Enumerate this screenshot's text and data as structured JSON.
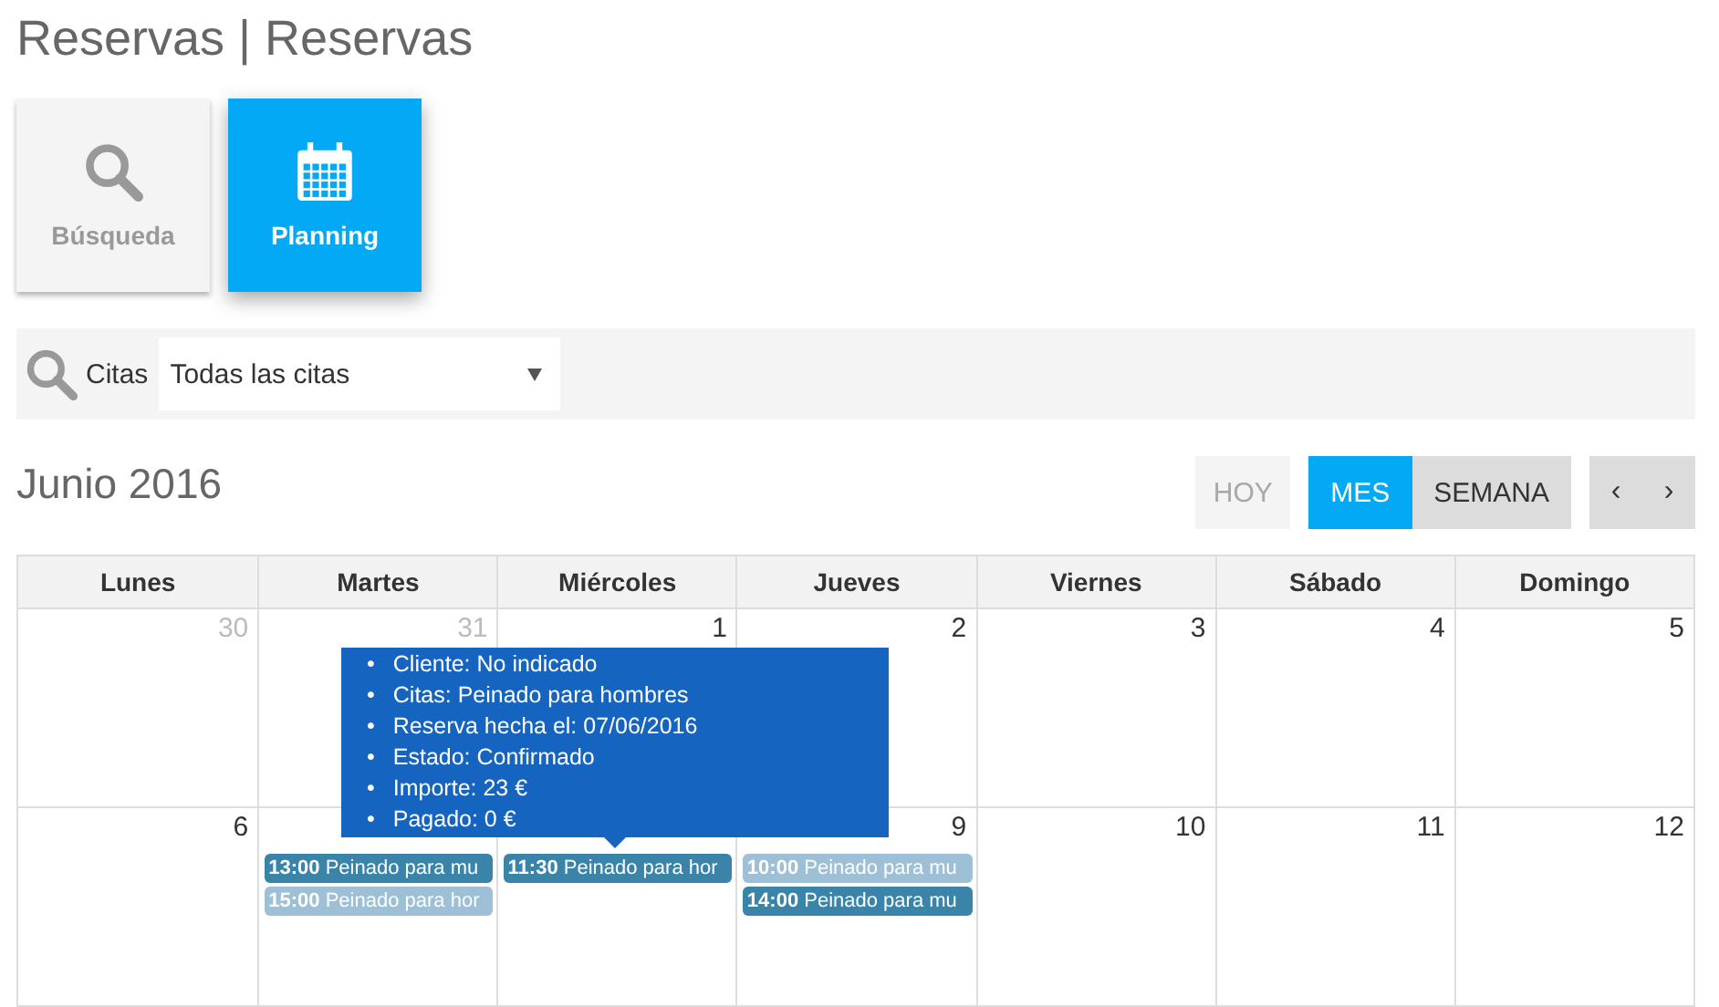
{
  "page_title": "Reservas | Reservas",
  "tiles": [
    {
      "label": "Búsqueda",
      "kind": "search",
      "selected": false
    },
    {
      "label": "Planning",
      "kind": "calendar",
      "selected": true
    }
  ],
  "filter": {
    "label": "Citas",
    "value": "Todas las citas"
  },
  "calendar": {
    "title": "Junio 2016",
    "today_button": {
      "label": "HOY",
      "disabled": true
    },
    "views": [
      {
        "label": "MES",
        "selected": true
      },
      {
        "label": "SEMANA",
        "selected": false
      }
    ],
    "nav": [
      "‹",
      "›"
    ],
    "weekdays": [
      "Lunes",
      "Martes",
      "Miércoles",
      "Jueves",
      "Viernes",
      "Sábado",
      "Domingo"
    ],
    "weeks": [
      [
        {
          "day": "30",
          "other_month": true
        },
        {
          "day": "31",
          "other_month": true
        },
        {
          "day": "1",
          "other_month": false
        },
        {
          "day": "2",
          "other_month": false
        },
        {
          "day": "3",
          "other_month": false
        },
        {
          "day": "4",
          "other_month": false
        },
        {
          "day": "5",
          "other_month": false
        }
      ],
      [
        {
          "day": "6",
          "other_month": false
        },
        {
          "events": [
            {
              "time": "13:00",
              "title": "Peinado para mu",
              "color": "#3a84aa"
            },
            {
              "time": "15:00",
              "title": "Peinado para hor",
              "color": "#9dc0d6"
            }
          ]
        },
        {
          "events": [
            {
              "time": "11:30",
              "title": "Peinado para hor",
              "color": "#3a84aa"
            }
          ]
        },
        {
          "day": "9",
          "other_month": false,
          "events": [
            {
              "time": "10:00",
              "title": "Peinado para mu",
              "color": "#9dc0d6"
            },
            {
              "time": "14:00",
              "title": "Peinado para mu",
              "color": "#3a84aa"
            }
          ]
        },
        {
          "day": "10",
          "other_month": false
        },
        {
          "day": "11",
          "other_month": false
        },
        {
          "day": "12",
          "other_month": false
        }
      ]
    ],
    "tooltip": {
      "marker": "•",
      "items": [
        "Cliente: No indicado",
        "Citas: Peinado para hombres",
        "Reserva hecha el: 07/06/2016",
        "Estado: Confirmado",
        "Importe: 23 €",
        "Pagado: 0 €"
      ]
    }
  }
}
